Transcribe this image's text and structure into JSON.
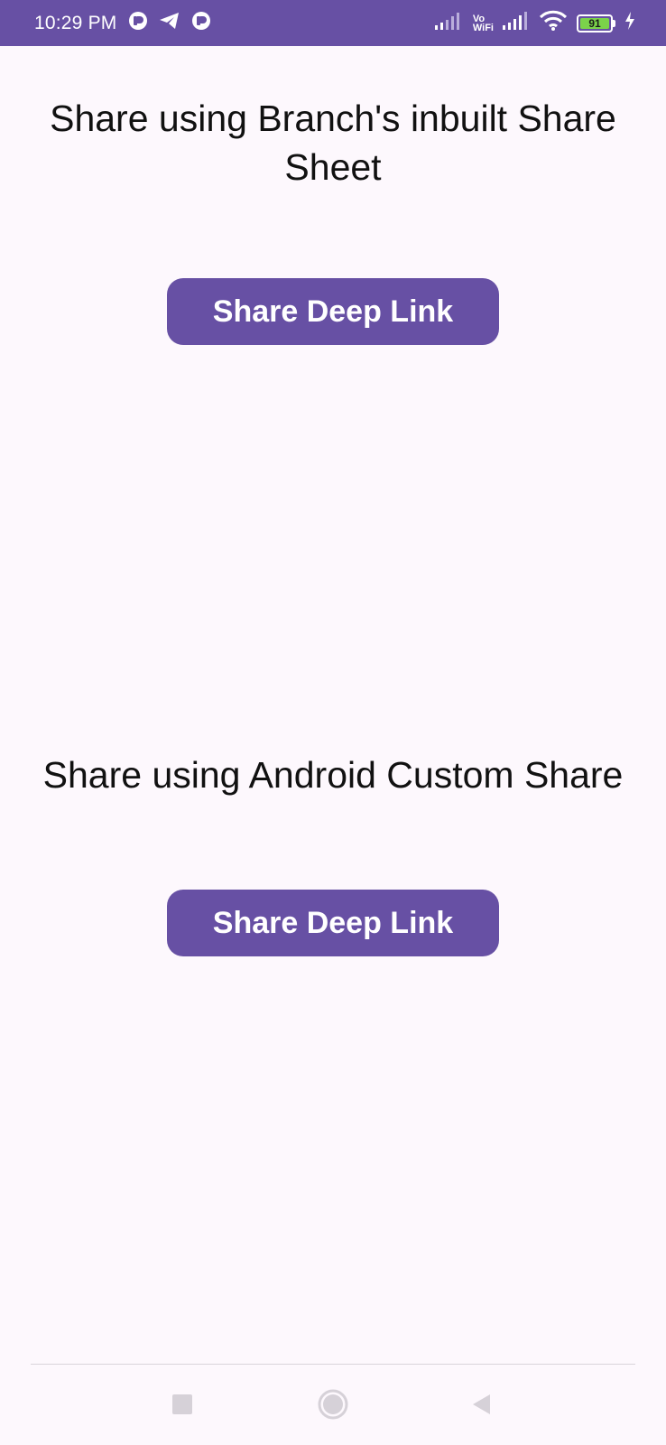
{
  "status_bar": {
    "time": "10:29 PM",
    "vo": "Vo",
    "wifi_label": "WiFi",
    "battery_level": "91",
    "icons_left": [
      "app-notification-icon",
      "telegram-icon",
      "app-notification-icon"
    ],
    "icons_right": [
      "signal-icon",
      "vowifi-icon",
      "signal-icon",
      "wifi-icon",
      "battery-icon",
      "charging-icon"
    ]
  },
  "sections": [
    {
      "heading": "Share using Branch's inbuilt Share Sheet",
      "button_label": "Share Deep Link"
    },
    {
      "heading": "Share using Android Custom Share",
      "button_label": "Share Deep Link"
    }
  ],
  "nav_bar": {
    "icons": [
      "recents-icon",
      "home-icon",
      "back-icon"
    ]
  },
  "colors": {
    "accent": "#6750a4",
    "background": "#fdf8fd",
    "battery_fill": "#7bd34a"
  }
}
